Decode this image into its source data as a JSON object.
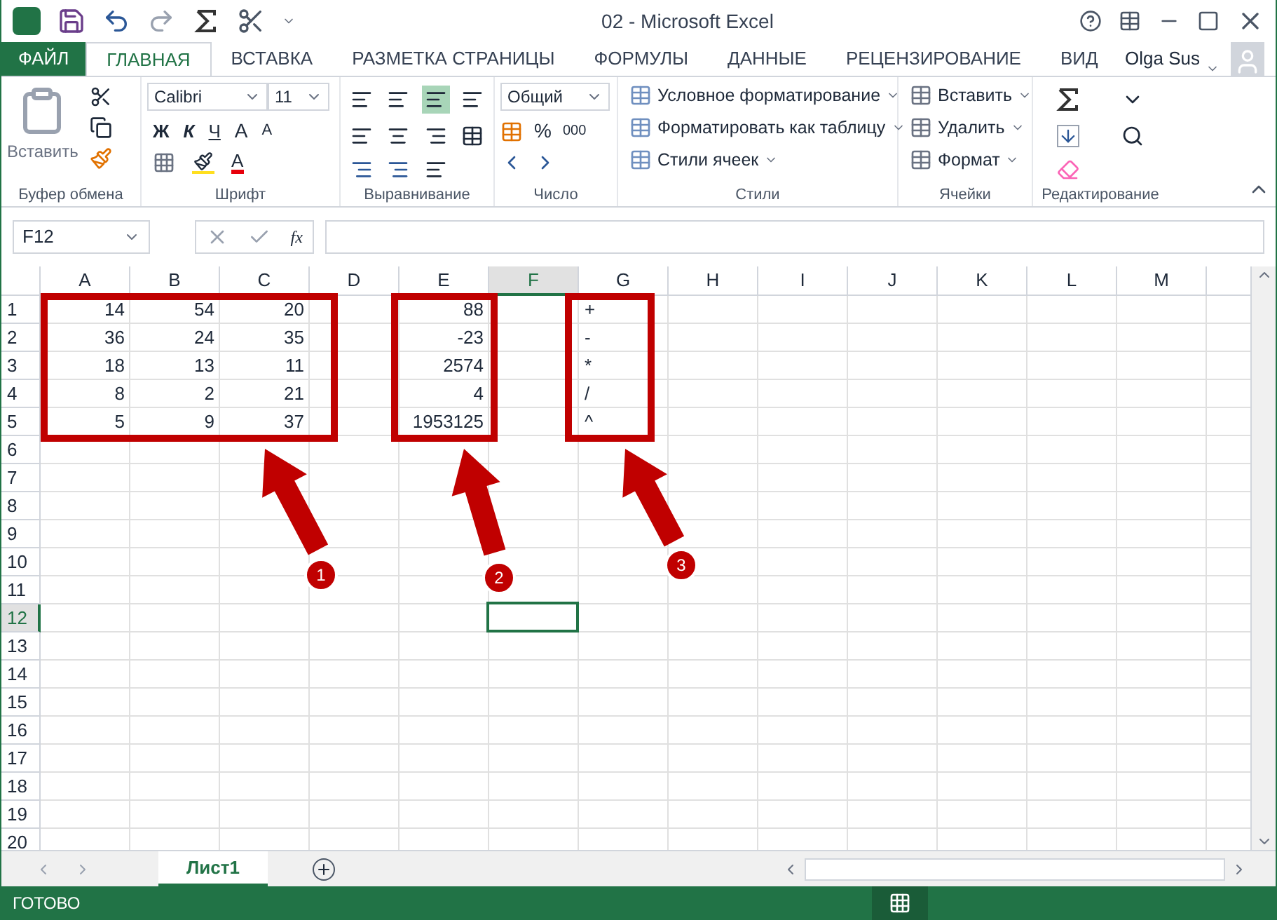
{
  "window": {
    "title": "02 - Microsoft Excel",
    "user": "Olga Sus"
  },
  "file_tab": {
    "label": "ФАЙЛ"
  },
  "tabs": [
    {
      "label": "ГЛАВНАЯ",
      "selected": true
    },
    {
      "label": "ВСТАВКА",
      "selected": false
    },
    {
      "label": "РАЗМЕТКА СТРАНИЦЫ",
      "selected": false
    },
    {
      "label": "ФОРМУЛЫ",
      "selected": false
    },
    {
      "label": "ДАННЫЕ",
      "selected": false
    },
    {
      "label": "РЕЦЕНЗИРОВАНИЕ",
      "selected": false
    },
    {
      "label": "ВИД",
      "selected": false
    }
  ],
  "ribbon": {
    "clipboard": {
      "paste": "Вставить",
      "label": "Буфер обмена"
    },
    "font": {
      "name": "Calibri",
      "size": "11",
      "bold": "Ж",
      "italic": "К",
      "underline": "Ч",
      "grow": "A",
      "shrink": "A",
      "font_color_letter": "A",
      "label": "Шрифт"
    },
    "alignment": {
      "label": "Выравнивание"
    },
    "number": {
      "format": "Общий",
      "percent": "%",
      "thousands": "000",
      "label": "Число"
    },
    "styles": {
      "items": [
        "Условное форматирование",
        "Форматировать как таблицу",
        "Стили ячеек"
      ],
      "label": "Стили"
    },
    "cells": {
      "items": [
        "Вставить",
        "Удалить",
        "Формат"
      ],
      "label": "Ячейки"
    },
    "editing": {
      "label": "Редактирование"
    }
  },
  "formula_bar": {
    "name_box": "F12",
    "fx": "fx"
  },
  "sheet": {
    "columns": [
      {
        "label": "A",
        "selected": false
      },
      {
        "label": "B",
        "selected": false
      },
      {
        "label": "C",
        "selected": false
      },
      {
        "label": "D",
        "selected": false
      },
      {
        "label": "E",
        "selected": false
      },
      {
        "label": "F",
        "selected": true
      },
      {
        "label": "G",
        "selected": false
      },
      {
        "label": "H",
        "selected": false
      },
      {
        "label": "I",
        "selected": false
      },
      {
        "label": "J",
        "selected": false
      },
      {
        "label": "K",
        "selected": false
      },
      {
        "label": "L",
        "selected": false
      },
      {
        "label": "M",
        "selected": false
      }
    ],
    "rows": [
      {
        "label": "1",
        "selected": false,
        "cells": [
          {
            "kind": "number",
            "value": "14"
          },
          {
            "kind": "number",
            "value": "54"
          },
          {
            "kind": "number",
            "value": "20"
          },
          {
            "kind": "empty"
          },
          {
            "kind": "number",
            "value": "88"
          },
          {
            "kind": "empty"
          },
          {
            "kind": "text",
            "value": "+"
          }
        ]
      },
      {
        "label": "2",
        "selected": false,
        "cells": [
          {
            "kind": "number",
            "value": "36"
          },
          {
            "kind": "number",
            "value": "24"
          },
          {
            "kind": "number",
            "value": "35"
          },
          {
            "kind": "empty"
          },
          {
            "kind": "number",
            "value": "-23"
          },
          {
            "kind": "empty"
          },
          {
            "kind": "text",
            "value": "-"
          }
        ]
      },
      {
        "label": "3",
        "selected": false,
        "cells": [
          {
            "kind": "number",
            "value": "18"
          },
          {
            "kind": "number",
            "value": "13"
          },
          {
            "kind": "number",
            "value": "11"
          },
          {
            "kind": "empty"
          },
          {
            "kind": "number",
            "value": "2574"
          },
          {
            "kind": "empty"
          },
          {
            "kind": "text",
            "value": "*"
          }
        ]
      },
      {
        "label": "4",
        "selected": false,
        "cells": [
          {
            "kind": "number",
            "value": "8"
          },
          {
            "kind": "number",
            "value": "2"
          },
          {
            "kind": "number",
            "value": "21"
          },
          {
            "kind": "empty"
          },
          {
            "kind": "number",
            "value": "4"
          },
          {
            "kind": "empty"
          },
          {
            "kind": "text",
            "value": "/"
          }
        ]
      },
      {
        "label": "5",
        "selected": false,
        "cells": [
          {
            "kind": "number",
            "value": "5"
          },
          {
            "kind": "number",
            "value": "9"
          },
          {
            "kind": "number",
            "value": "37"
          },
          {
            "kind": "empty"
          },
          {
            "kind": "number",
            "value": "1953125"
          },
          {
            "kind": "empty"
          },
          {
            "kind": "text",
            "value": "^"
          }
        ]
      },
      {
        "label": "6",
        "selected": false
      },
      {
        "label": "7",
        "selected": false
      },
      {
        "label": "8",
        "selected": false
      },
      {
        "label": "9",
        "selected": false
      },
      {
        "label": "10",
        "selected": false
      },
      {
        "label": "11",
        "selected": false
      },
      {
        "label": "12",
        "selected": true
      },
      {
        "label": "13",
        "selected": false
      },
      {
        "label": "14",
        "selected": false
      },
      {
        "label": "15",
        "selected": false
      },
      {
        "label": "16",
        "selected": false
      },
      {
        "label": "17",
        "selected": false
      },
      {
        "label": "18",
        "selected": false
      },
      {
        "label": "19",
        "selected": false
      },
      {
        "label": "20",
        "selected": false
      }
    ]
  },
  "annotations": [
    {
      "label": "1"
    },
    {
      "label": "2"
    },
    {
      "label": "3"
    }
  ],
  "sheet_tabs": [
    {
      "label": "Лист1",
      "selected": true
    }
  ],
  "status_bar": {
    "text": "ГОТОВО"
  }
}
